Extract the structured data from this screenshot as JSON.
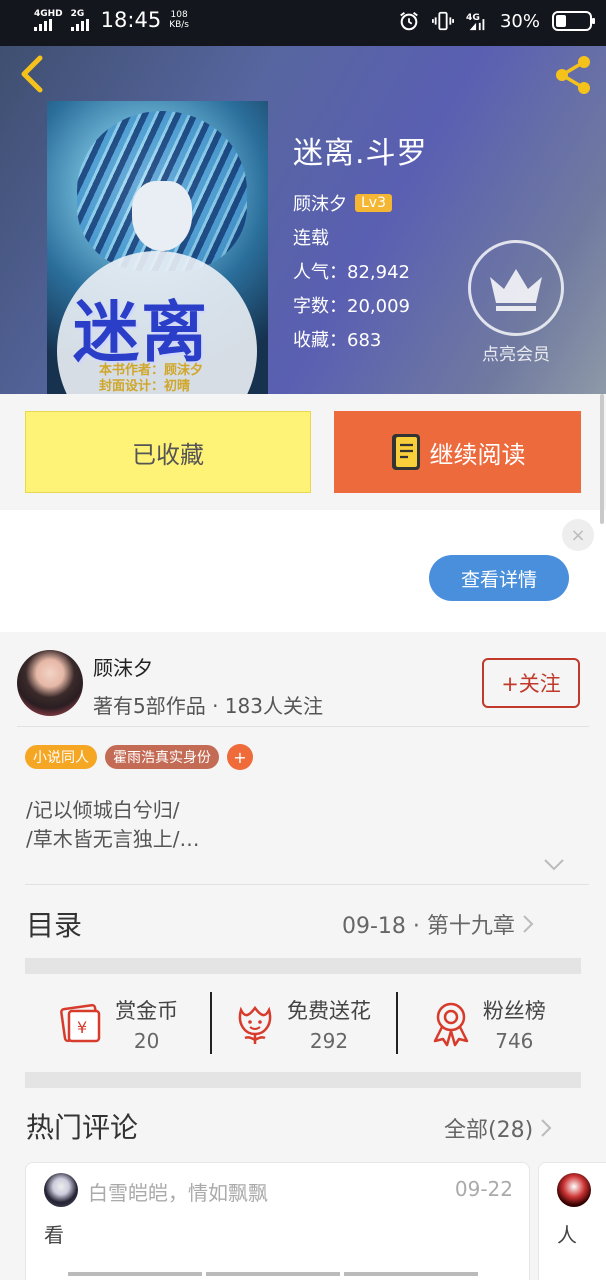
{
  "status_bar": {
    "network1": "4GHD",
    "network2": "2G",
    "time": "18:45",
    "speed_value": "108",
    "speed_unit": "KB/s",
    "network3": "4G",
    "battery": "30%"
  },
  "book": {
    "title": "迷离.斗罗",
    "author": "顾沫夕",
    "level": "Lv3",
    "status": "连载",
    "popularity": "人气：82,942",
    "word_count": "字数：20,009",
    "favorites": "收藏：683",
    "cover_title": "迷离",
    "cover_sub1": "本书作者：顾沫夕",
    "cover_sub2": "封面设计：初晴"
  },
  "vip": {
    "label": "点亮会员"
  },
  "actions": {
    "collected_label": "已收藏",
    "read_label": "继续阅读"
  },
  "ad": {
    "detail_label": "查看详情",
    "close_icon": "×"
  },
  "author_card": {
    "name": "顾沫夕",
    "meta": "著有5部作品 · 183人关注",
    "follow_label": "+关注",
    "tags": [
      {
        "label": "小说同人",
        "color": "#f5a623"
      },
      {
        "label": "霍雨浩真实身份",
        "color": "#c46b55"
      }
    ],
    "tag_add": "+",
    "intro_line1": "/记以倾城白兮归/",
    "intro_line2": "/草木皆无言独上/…"
  },
  "catalog": {
    "title": "目录",
    "latest": "09-18 · 第十九章"
  },
  "stats": [
    {
      "label": "赏金币",
      "value": "20",
      "icon": "red-envelope-icon"
    },
    {
      "label": "免费送花",
      "value": "292",
      "icon": "flower-icon"
    },
    {
      "label": "粉丝榜",
      "value": "746",
      "icon": "medal-icon"
    }
  ],
  "comments": {
    "title": "热门评论",
    "all_label": "全部(28)",
    "items": [
      {
        "user": "白雪皑皑，情如飘飘",
        "date": "09-22",
        "text": "看"
      },
      {
        "text": "人"
      }
    ]
  },
  "colors": {
    "accent": "#ec6a3c",
    "collected": "#fff377",
    "follow": "#c0392b",
    "detail": "#4a8fdc"
  }
}
